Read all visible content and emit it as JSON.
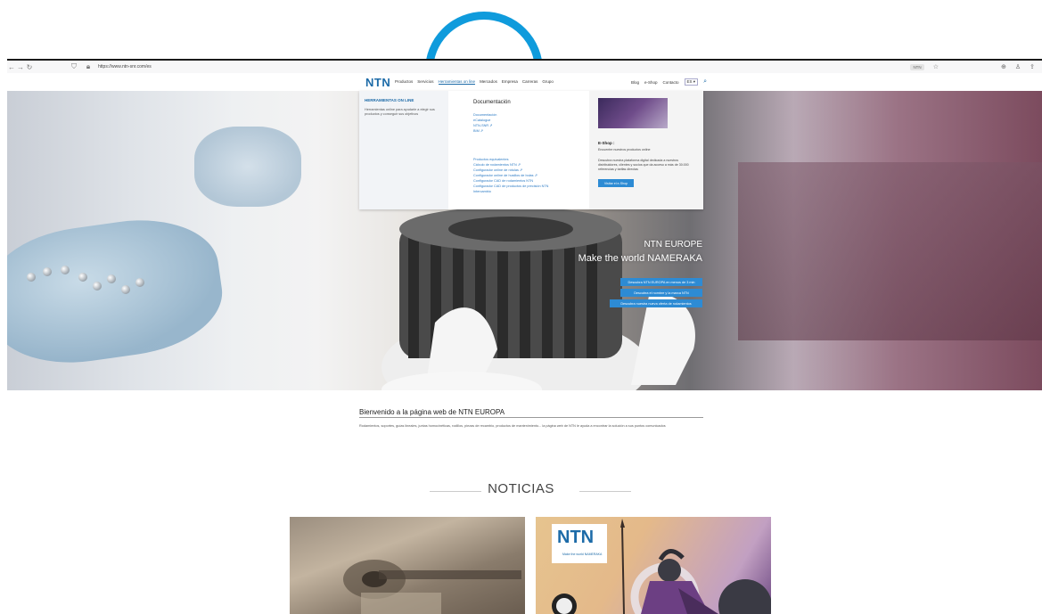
{
  "browser": {
    "url": "https://www.ntn-snr.com/es",
    "pill": "NTN",
    "icons": [
      "back-icon",
      "forward-icon",
      "reload-icon",
      "shield-icon",
      "lock-icon",
      "star-icon",
      "extension-icon",
      "account-icon",
      "share-icon"
    ]
  },
  "header": {
    "logo": "NTN",
    "nav": [
      "Productos",
      "Servicios",
      "Herramientas on line",
      "Mercados",
      "Empresa",
      "Carreras",
      "Grupo"
    ],
    "active_index": 2,
    "right_nav": [
      "Blog",
      "e-Shop",
      "Contacto"
    ],
    "lang": "ES ▾"
  },
  "megamenu": {
    "left_title": "HERRAMIENTAS ON LINE",
    "left_text": "Herramientas online para ayudarle a elegir sus productos y conseguir sus objetivos",
    "doc_title": "Documentación",
    "links_a": [
      "Documentación",
      "eCatalogue",
      "NTN-SNR ⇗",
      "BIM ⇗"
    ],
    "links_b": [
      "Productos equivalentes",
      "Cálculo de rodamientos NTN ⇗",
      "Configurador online de rótulas ⇗",
      "Configurador online de husillos de bolas ⇗",
      "Configurador CAD de rodamientos NTN",
      "Configurador CAD de productos de precisión NTN",
      "Intercambio"
    ],
    "right_title": "E-Shop :",
    "right_sub": "Encuentre nuestros productos online",
    "right_text": "Descubra nuestra plataforma digital dedicada a nuestros distribuidores, clientes y socios que da acceso a más de 30.000 referencias y tarifas directas",
    "right_button": "Visitar el e-Shop"
  },
  "hero": {
    "title": "NTN EUROPE",
    "subtitle": "Make the world NAMERAKA",
    "buttons": [
      "Descubra NTN EUROPA en menos de 3 min",
      "Descubra el nombre y la marca NTN",
      "Descubra nuestra nueva oferta de rodamientos"
    ]
  },
  "welcome": {
    "title": "Bienvenido a la página web de NTN EUROPA",
    "text": "Rodamientos, soportes, guías lineales, juntas homocinéticas, rodillos, piezas de recambio, productos de mantenimiento... la página web de NTN le ayuda a encontrar la solución a sus puntos comunicados"
  },
  "news": {
    "title": "NOTICIAS",
    "card2_logo": "NTN",
    "card2_tagline": "Make the world NAMERAKA"
  }
}
